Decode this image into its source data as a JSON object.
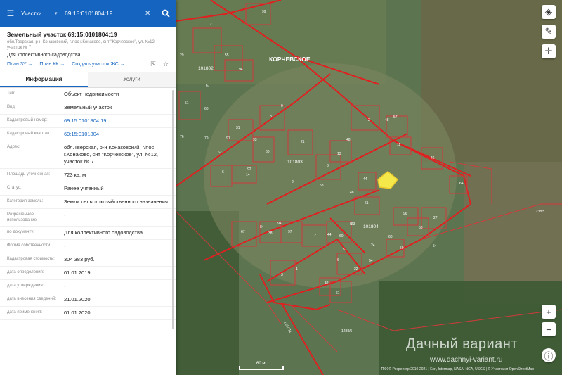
{
  "search": {
    "layer": "Участки",
    "query": "69:15:0101804:19"
  },
  "parcel": {
    "title": "Земельный участок 69:15:0101804:19",
    "address_short": "обл.Тверская, р-н Конаковский, г/пос г.Конаково, снт \"Корчевское\", ул. №12, участок № 7",
    "purpose": "Для коллективного садоводства",
    "links": [
      "План ЗУ →",
      "План КК →",
      "Создать участок ЖС →"
    ]
  },
  "tabs": [
    "Информация",
    "Услуги"
  ],
  "info": [
    {
      "k": "Тип:",
      "v": "Объект недвижимости"
    },
    {
      "k": "Вид:",
      "v": "Земельный участок"
    },
    {
      "k": "Кадастровый номер:",
      "v": "69:15:0101804:19",
      "link": true
    },
    {
      "k": "Кадастровый квартал:",
      "v": "69:15:0101804",
      "link": true
    },
    {
      "k": "Адрес:",
      "v": "обл.Тверская, р-н Конаковский, г/пос г.Конаково, снт \"Корчевское\", ул. №12, участок № 7"
    },
    {
      "k": "Площадь уточненная:",
      "v": "723 кв. м"
    },
    {
      "k": "Статус:",
      "v": "Ранее учтенный"
    },
    {
      "k": "Категория земель:",
      "v": "Земли сельскохозяйственного назначения"
    },
    {
      "k": "Разрешенное использование:",
      "v": "-"
    },
    {
      "k": "по документу:",
      "v": "Для коллективного садоводства"
    },
    {
      "k": "Форма собственности:",
      "v": "-"
    },
    {
      "k": "Кадастровая стоимость:",
      "v": "304 383 руб."
    },
    {
      "k": "дата определения:",
      "v": "01.01.2019"
    },
    {
      "k": "дата утверждения:",
      "v": "-"
    },
    {
      "k": "дата внесения сведений:",
      "v": "21.01.2020"
    },
    {
      "k": "дата применения:",
      "v": "01.01.2020"
    }
  ],
  "map": {
    "place": "КОРЧЕВСКОЕ",
    "quarters": [
      "101802",
      "101803",
      "101804"
    ],
    "edge_labels": [
      "1238/5",
      "1238/5",
      "1207/11"
    ],
    "plots": [
      "99",
      "12",
      "29",
      "55",
      "94",
      "67",
      "51",
      "60",
      "8",
      "9",
      "76",
      "79",
      "62",
      "31",
      "91",
      "60",
      "93",
      "92",
      "6",
      "21",
      "14",
      "2",
      "3",
      "13",
      "44",
      "2",
      "48",
      "57",
      "11",
      "46",
      "64",
      "58",
      "48",
      "61",
      "48",
      "96",
      "58",
      "27",
      "59",
      "94",
      "44",
      "2",
      "94",
      "38",
      "97",
      "60",
      "6",
      "22",
      "42",
      "61",
      "67",
      "84",
      "1",
      "3",
      "54",
      "57",
      "23",
      "24",
      "60",
      "54"
    ],
    "scale": "60 м",
    "attribution": "ПКК © Росреестр 2010-2021 | Esri, Intermap, NASA, NGA, USGS | © Участники OpenStreetMap"
  },
  "watermark": {
    "text": "Дачный вариант",
    "url": "www.dachnyi-variant.ru"
  },
  "colors": {
    "accent": "#1565c0",
    "boundary": "#e41c1c",
    "selected": "#f5e84a"
  },
  "icons": {
    "menu": "menu-icon",
    "search": "search-icon",
    "layers": "layers-icon",
    "ruler": "ruler-icon",
    "locate": "locate-icon",
    "info": "info-icon"
  }
}
